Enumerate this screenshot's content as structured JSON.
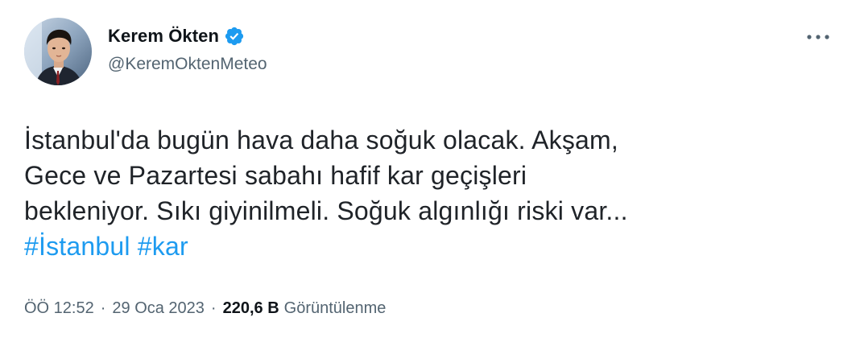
{
  "author": {
    "display_name": "Kerem Ökten",
    "handle": "@KeremOktenMeteo",
    "verified": true,
    "verified_color": "#1d9bf0"
  },
  "tweet": {
    "lines": [
      "İstanbul'da bugün hava daha soğuk olacak. Akşam,",
      "Gece ve Pazartesi sabahı hafif kar geçişleri",
      "bekleniyor. Sıkı giyinilmeli. Soğuk algınlığı riski var..."
    ],
    "hashtags": [
      "#İstanbul",
      "#kar"
    ],
    "hashtag_color": "#1d9bf0"
  },
  "meta": {
    "time": "ÖÖ 12:52",
    "separator": "·",
    "date": "29 Oca 2023",
    "views_count": "220,6 B",
    "views_label": "Görüntülenme"
  },
  "icons": {
    "more": "more-horizontal-icon",
    "verified": "verified-badge-icon"
  }
}
